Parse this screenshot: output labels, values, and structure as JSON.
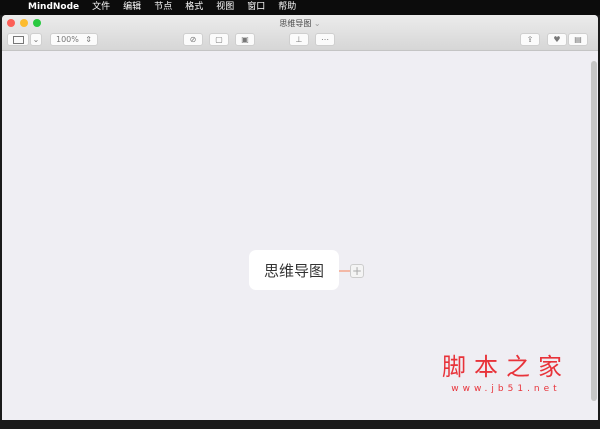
{
  "menubar": {
    "apple": "",
    "app": "MindNode",
    "items": [
      "文件",
      "编辑",
      "节点",
      "格式",
      "视图",
      "窗口",
      "帮助"
    ]
  },
  "window": {
    "title": "思维导图",
    "zoom": "100%"
  },
  "canvas": {
    "root_node": "思维导图",
    "add_icon": "+"
  },
  "watermark": {
    "text": "脚本之家",
    "url": "www.jb51.net"
  }
}
